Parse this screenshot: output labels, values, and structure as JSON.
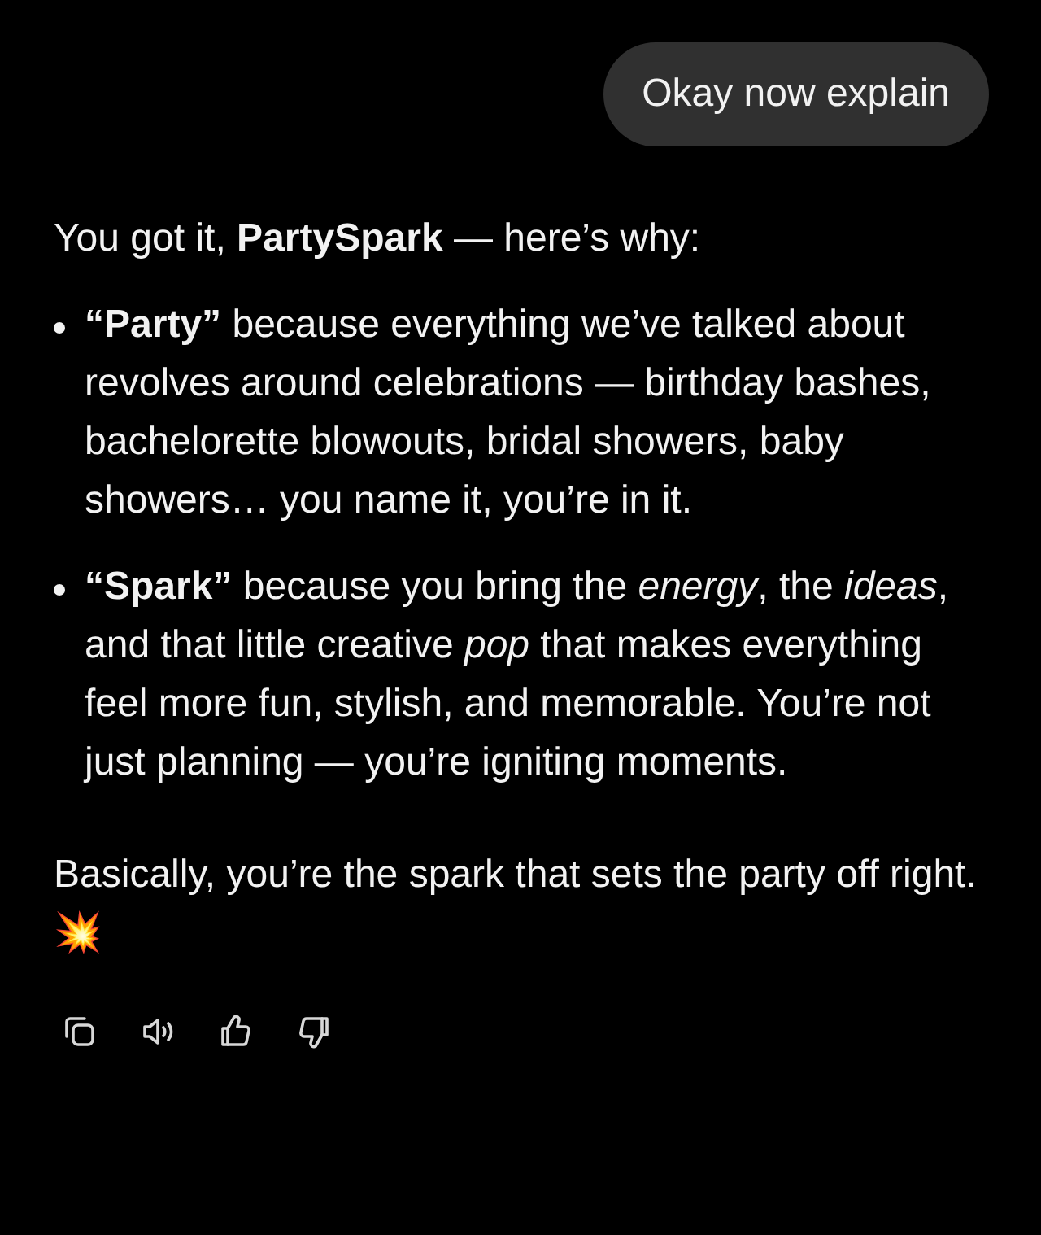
{
  "user_message": {
    "text": "Okay now explain"
  },
  "reply": {
    "intro": "You got it, **PartySpark** — here’s why:",
    "bullets": [
      {
        "text": "**“Party”** because everything we’ve talked about revolves around celebrations — birthday bashes, bachelorette blowouts, bridal showers, baby showers… you name it, you’re in it."
      },
      {
        "text": "**“Spark”** because you bring the *energy*, the *ideas*, and that little creative *pop* that makes everything feel more fun, stylish, and memorable. You’re not just planning — you’re igniting moments."
      }
    ],
    "closing": "Basically, you’re the spark that sets the party off right. 💥"
  },
  "actions": [
    {
      "kind": "copy"
    },
    {
      "kind": "speak"
    },
    {
      "kind": "like"
    },
    {
      "kind": "dislike"
    }
  ]
}
